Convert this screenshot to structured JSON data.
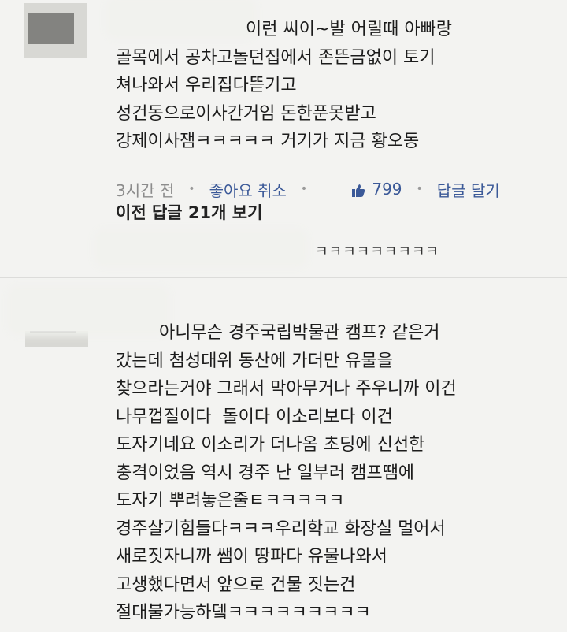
{
  "comment1": {
    "text": " 이런 씨이~발 어릴때 아빠랑\n골목에서 공차고놀던집에서 존뜬금없이 토기\n쳐나와서 우리집다뜯기고\n성건동으로이사간거임 돈한푼못받고\n강제이사잼ㅋㅋㅋㅋㅋ 거기가 지금 황오동",
    "time": "3시간 전",
    "like_link": "좋아요 취소",
    "like_count": "799",
    "reply_link": "답글 달기",
    "thumb_icon": "thumbs-up-icon"
  },
  "previous_replies": "이전 답글 21개 보기",
  "reply_snippet": "ㅋㅋㅋㅋㅋㅋㅋㅋㅋ",
  "comment2": {
    "text": " 아니무슨 경주국립박물관 캠프? 같은거\n갔는데 첨성대위 동산에 가더만 유물을\n찾으라는거야 그래서 막아무거나 주우니까 이건\n나무껍질이다  돌이다 이소리보다 이건\n도자기네요 이소리가 더나옴 초딩에 신선한\n충격이었음 역시 경주 난 일부러 캠프땜에\n도자기 뿌려놓은줄ㅌㅋㅋㅋㅋㅋ\n경주살기힘들다ㅋㅋㅋ우리학교 화장실 멀어서\n새로짓자니까 쌤이 땅파다 유물나와서\n고생했다면서 앞으로 건물 짓는건\n절대불가능하뎈ㅋㅋㅋㅋㅋㅋㅋㅋㅋ"
  },
  "colors": {
    "link": "#3b5998",
    "meta": "#8c8c8c",
    "background": "#f3f3f1"
  }
}
